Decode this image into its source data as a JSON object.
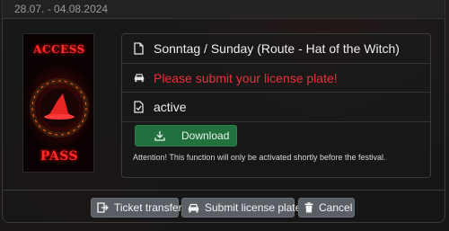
{
  "header": {
    "date_range": "28.07. - 04.08.2024"
  },
  "ticket_image": {
    "top_word": "ACCESS",
    "bottom_word": "PASS",
    "accent_color": "#ff2a2a"
  },
  "info": {
    "event": {
      "icon": "document-icon",
      "text": "Sonntag / Sunday (Route - Hat of the Witch)"
    },
    "vehicle": {
      "icon": "car-icon",
      "text": "Please submit your license plate!",
      "color": "#e8303b"
    },
    "status": {
      "icon": "check-document-icon",
      "text": "active"
    },
    "download": {
      "icon": "download-icon",
      "label": "Download",
      "color": "#21703d"
    },
    "note": "Attention! This function will only be activated shortly before the festival."
  },
  "actions": {
    "transfer": {
      "icon": "transfer-icon",
      "label": "Ticket transfer"
    },
    "plate": {
      "icon": "car-icon",
      "label": "Submit license plate"
    },
    "cancel": {
      "icon": "trash-icon",
      "label": "Cancel"
    }
  }
}
